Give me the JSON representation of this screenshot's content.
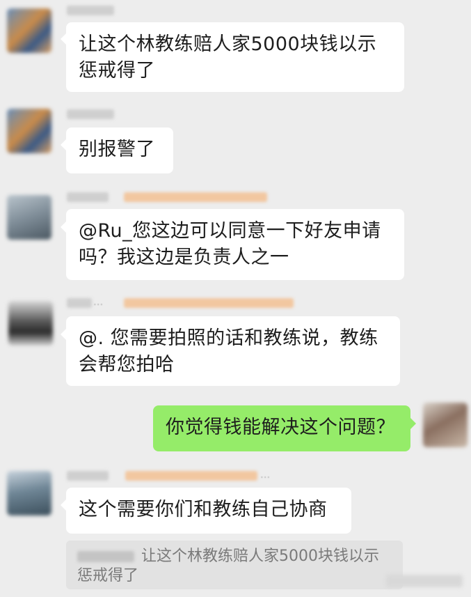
{
  "messages": [
    {
      "side": "left",
      "text": "让这个林教练赔人家5000块钱以示惩戒得了"
    },
    {
      "side": "left",
      "text": "别报警了"
    },
    {
      "side": "left",
      "text": "@Ru_您这边可以同意一下好友申请吗？我这边是负责人之一"
    },
    {
      "side": "left",
      "nick_suffix": "...",
      "text": "@. 您需要拍照的话和教练说，教练会帮您拍哈"
    },
    {
      "side": "right",
      "text": "你觉得钱能解决这个问题？"
    },
    {
      "side": "left",
      "nick_suffix": "...",
      "text": "这个需要你们和教练自己协商"
    }
  ],
  "quote": {
    "text": "让这个林教练赔人家5000块钱以示惩戒得了"
  },
  "colors": {
    "background": "#ededed",
    "incoming_bubble": "#ffffff",
    "outgoing_bubble": "#95ec69"
  }
}
